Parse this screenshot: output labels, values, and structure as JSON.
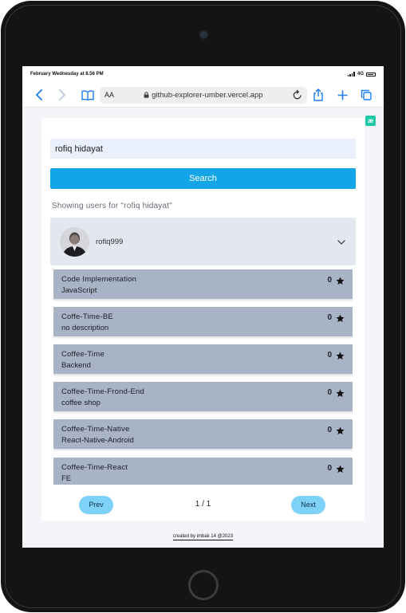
{
  "status_bar": {
    "time": "February Wednesday at 8.56 PM",
    "network": "4G"
  },
  "browser": {
    "text_size_label": "AA",
    "url": "github-explorer-umber.vercel.app"
  },
  "extension_badge": "æ",
  "search": {
    "value": "rofiq hidayat",
    "button_label": "Search"
  },
  "results": {
    "showing_text": "Showing users for \"rofiq hidayat\""
  },
  "user": {
    "username": "rofiq999"
  },
  "repos": [
    {
      "name": "Code Implementation",
      "description": "JavaScript",
      "stars": "0"
    },
    {
      "name": "Coffe-Time-BE",
      "description": "no description",
      "stars": "0"
    },
    {
      "name": "Coffee-Time",
      "description": "Backend",
      "stars": "0"
    },
    {
      "name": "Coffee-Time-Frond-End",
      "description": "coffee shop",
      "stars": "0"
    },
    {
      "name": "Coffee-Time-Native",
      "description": "React-Native-Android",
      "stars": "0"
    },
    {
      "name": "Coffee-Time-React",
      "description": "FE",
      "stars": "0"
    }
  ],
  "pagination": {
    "prev_label": "Prev",
    "page_info": "1 / 1",
    "next_label": "Next"
  },
  "footer": {
    "credit": "created by imbak 14 @2023"
  },
  "colors": {
    "accent": "#14a4e8",
    "repo_card": "#a9b3c6",
    "pager_button": "#7fd2f7",
    "ios_blue": "#1a7cf5"
  }
}
